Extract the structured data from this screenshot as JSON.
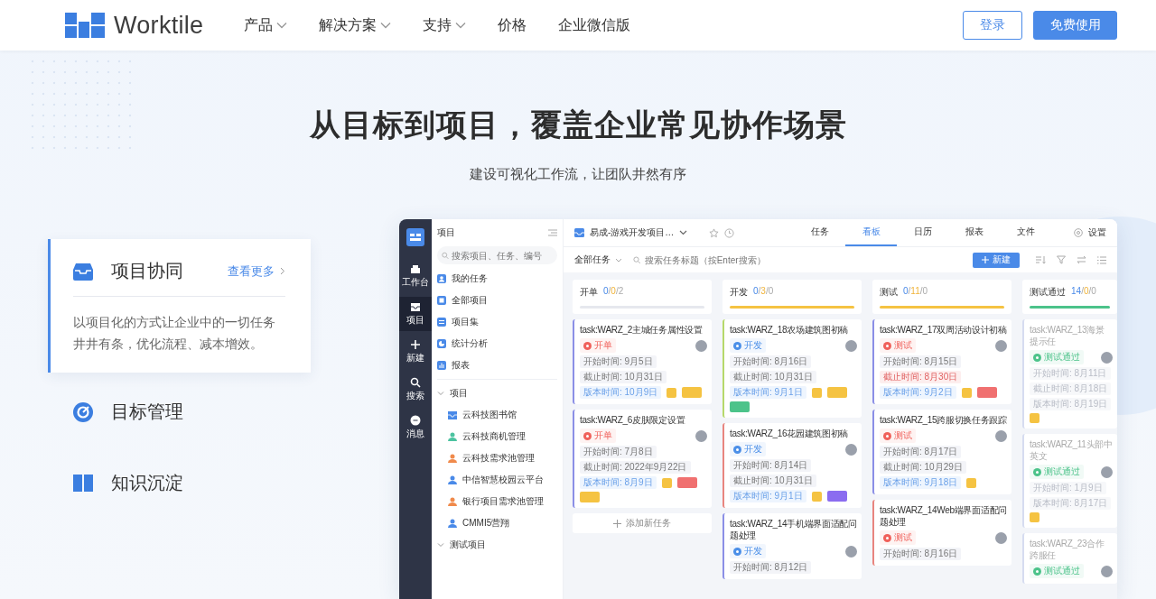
{
  "nav": {
    "logo": "Worktile",
    "items": [
      {
        "label": "产品",
        "has_menu": true
      },
      {
        "label": "解决方案",
        "has_menu": true
      },
      {
        "label": "支持",
        "has_menu": true
      },
      {
        "label": "价格",
        "has_menu": false
      },
      {
        "label": "企业微信版",
        "has_menu": false
      }
    ],
    "buttons": [
      {
        "label": "登录",
        "kind": "outline"
      },
      {
        "label": "免费使用",
        "kind": "primary"
      }
    ]
  },
  "hero": {
    "title": "从目标到项目，覆盖企业常见协作场景",
    "subtitle": "建设可视化工作流，让团队井然有序"
  },
  "features": [
    {
      "title": "项目协同",
      "selected": true,
      "link": "查看更多",
      "description": "以项目化的方式让企业中的一切任务井井有条，优化流程、减本增效。"
    },
    {
      "title": "目标管理",
      "selected": false
    },
    {
      "title": "知识沉淀",
      "selected": false
    }
  ],
  "app": {
    "rail": [
      {
        "label": "工作台",
        "selected": false
      },
      {
        "label": "项目",
        "selected": true
      },
      {
        "label": "新建",
        "selected": false
      },
      {
        "label": "搜索",
        "selected": false
      },
      {
        "label": "消息",
        "selected": false
      }
    ],
    "panel": {
      "title": "项目",
      "search_placeholder": "搜索项目、任务、编号",
      "nav": [
        "我的任务",
        "全部项目",
        "项目集",
        "统计分析",
        "报表"
      ],
      "groups": [
        {
          "label": "项目",
          "expanded": true,
          "children": [
            {
              "label": "云科技图书馆",
              "kind": "inbox",
              "color": "#4a8ae8"
            },
            {
              "label": "云科技商机管理",
              "kind": "person",
              "color": "#4cc3a0"
            },
            {
              "label": "云科技需求池管理",
              "kind": "person",
              "color": "#f08a4b"
            },
            {
              "label": "中信智慧校园云平台",
              "kind": "person",
              "color": "#4a8ae8"
            },
            {
              "label": "银行项目需求池管理",
              "kind": "person",
              "color": "#f08a4b"
            },
            {
              "label": "CMMI5营翔",
              "kind": "person",
              "color": "#4a8ae8"
            }
          ]
        },
        {
          "label": "测试项目",
          "expanded": true
        }
      ]
    },
    "project": {
      "name": "易成-游戏开发项目…",
      "tabs": [
        {
          "label": "任务",
          "selected": false
        },
        {
          "label": "看板",
          "selected": true
        },
        {
          "label": "日历",
          "selected": false
        },
        {
          "label": "报表",
          "selected": false
        },
        {
          "label": "文件",
          "selected": false
        }
      ],
      "settings": "设置",
      "filter": "全部任务",
      "search_placeholder": "搜索任务标题（按Enter搜索）",
      "new_button": "新建"
    },
    "columns": [
      {
        "title": "开单",
        "counts": "0/0/2",
        "color": "#e6e8ee",
        "faded": false,
        "add_task": "添加新任务",
        "cards": [
          {
            "title": "task:WARZ_2主城任务属性设置",
            "color": "#8b8fe6",
            "status": {
              "text": "开单",
              "color": "#f0605a"
            },
            "dates": [
              {
                "kind": "start",
                "text": "开始时间: 9月5日"
              },
              {
                "kind": "due",
                "text": "截止时间: 10月31日",
                "overdue": false
              },
              {
                "kind": "version",
                "text": "版本时间: 10月9日"
              }
            ],
            "tags": [
              {
                "kind": "square",
                "color": "#f5c342"
              },
              {
                "kind": "pill",
                "color": "#f5c342"
              }
            ]
          },
          {
            "title": "task:WARZ_6皮肤限定设置",
            "color": "#8b8fe6",
            "status": {
              "text": "开单",
              "color": "#f0605a"
            },
            "dates": [
              {
                "kind": "start",
                "text": "开始时间: 7月8日"
              },
              {
                "kind": "due",
                "text": "截止时间: 2022年9月22日",
                "overdue": false
              },
              {
                "kind": "version",
                "text": "版本时间: 8月9日"
              }
            ],
            "tags": [
              {
                "kind": "square",
                "color": "#f5c342"
              },
              {
                "kind": "pill",
                "color": "#f07070"
              },
              {
                "kind": "pill",
                "color": "#f5c342"
              }
            ]
          }
        ]
      },
      {
        "title": "开发",
        "counts": "0/3/0",
        "color": "#f5c342",
        "faded": false,
        "cards": [
          {
            "title": "task:WARZ_18农场建筑图初稿",
            "color": "#b6d86a",
            "status": {
              "text": "开发",
              "color": "#4b8fe8"
            },
            "dates": [
              {
                "kind": "start",
                "text": "开始时间: 8月16日"
              },
              {
                "kind": "due",
                "text": "截止时间: 10月31日",
                "overdue": false
              },
              {
                "kind": "version",
                "text": "版本时间: 9月1日"
              }
            ],
            "tags": [
              {
                "kind": "square",
                "color": "#f5c342"
              },
              {
                "kind": "pill",
                "color": "#f5c342"
              },
              {
                "kind": "pill",
                "color": "#4cc38a"
              }
            ]
          },
          {
            "title": "task:WARZ_16花园建筑图初稿",
            "color": "#e8857f",
            "status": {
              "text": "开发",
              "color": "#4b8fe8"
            },
            "dates": [
              {
                "kind": "start",
                "text": "开始时间: 8月14日"
              },
              {
                "kind": "due",
                "text": "截止时间: 10月31日",
                "overdue": false
              },
              {
                "kind": "version",
                "text": "版本时间: 9月1日"
              }
            ],
            "tags": [
              {
                "kind": "square",
                "color": "#f5c342"
              },
              {
                "kind": "pill",
                "color": "#8b6cf0"
              }
            ]
          },
          {
            "title": "task:WARZ_14手机端界面适配问题处理",
            "color": "#8b8fe6",
            "status": {
              "text": "开发",
              "color": "#4b8fe8"
            },
            "dates": [
              {
                "kind": "start",
                "text": "开始时间: 8月12日"
              }
            ]
          }
        ]
      },
      {
        "title": "测试",
        "counts": "0/11/0",
        "color": "#f5c342",
        "faded": false,
        "cards": [
          {
            "title": "task:WARZ_17双周活动设计初稿",
            "color": "#8b8fe6",
            "status": {
              "text": "测试",
              "color": "#f0605a"
            },
            "dates": [
              {
                "kind": "start",
                "text": "开始时间: 8月15日"
              },
              {
                "kind": "due",
                "text": "截止时间: 8月30日",
                "overdue": true
              },
              {
                "kind": "version",
                "text": "版本时间: 9月2日"
              }
            ],
            "tags": [
              {
                "kind": "square",
                "color": "#f5c342"
              },
              {
                "kind": "pill",
                "color": "#f07070"
              }
            ]
          },
          {
            "title": "task:WARZ_15跨服切换任务跟踪",
            "color": "#8b8fe6",
            "status": {
              "text": "测试",
              "color": "#f0605a"
            },
            "dates": [
              {
                "kind": "start",
                "text": "开始时间: 8月17日"
              },
              {
                "kind": "due",
                "text": "截止时间: 10月29日",
                "overdue": false
              },
              {
                "kind": "version",
                "text": "版本时间: 9月18日"
              }
            ],
            "tags": [
              {
                "kind": "square",
                "color": "#f5c342"
              }
            ]
          },
          {
            "title": "task:WARZ_14Web端界面适配问题处理",
            "color": "#e8857f",
            "status": {
              "text": "测试",
              "color": "#f0605a"
            },
            "dates": [
              {
                "kind": "start",
                "text": "开始时间: 8月16日"
              }
            ]
          }
        ]
      },
      {
        "title": "测试通过",
        "counts": "14/0/0",
        "color": "#4cc38a",
        "faded": true,
        "cards": [
          {
            "title": "task:WARZ_13海景提示任",
            "color": "#d6dcf0",
            "status": {
              "text": "测试通过",
              "color": "#4cc38a"
            },
            "dates": [
              {
                "kind": "start",
                "text": "开始时间: 8月11日"
              },
              {
                "kind": "due",
                "text": "截止时间: 8月18日",
                "overdue": false
              },
              {
                "kind": "version",
                "text": "版本时间: 8月19日"
              }
            ],
            "tags": [
              {
                "kind": "square",
                "color": "#f5c342"
              }
            ]
          },
          {
            "title": "task:WARZ_11头部中英文",
            "color": "#d6dcf0",
            "status": {
              "text": "测试通过",
              "color": "#4cc38a"
            },
            "dates": [
              {
                "kind": "start",
                "text": "开始时间: 1月9日"
              },
              {
                "kind": "version",
                "text": "版本时间: 8月17日"
              }
            ],
            "tags": [
              {
                "kind": "square",
                "color": "#f5c342"
              }
            ]
          },
          {
            "title": "task:WARZ_23合作跨服任",
            "color": "#d6dcf0",
            "status": {
              "text": "测试通过",
              "color": "#4cc38a"
            }
          }
        ]
      }
    ]
  }
}
